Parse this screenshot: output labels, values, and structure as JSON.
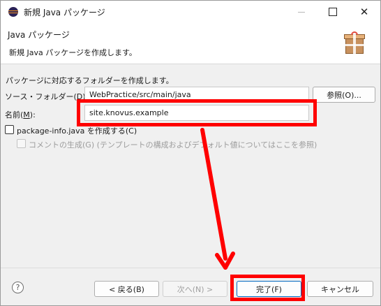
{
  "window": {
    "title": "新規 Java パッケージ"
  },
  "banner": {
    "title": "Java パッケージ",
    "description": "新規 Java パッケージを作成します。"
  },
  "form": {
    "instruction": "パッケージに対応するフォルダーを作成します。",
    "source_folder": {
      "label": "ソース・フォルダー(",
      "mnemonic": "D",
      "suffix": "):",
      "value": "WebPractice/src/main/java",
      "browse_button": "参照(O)..."
    },
    "name": {
      "label": "名前(",
      "mnemonic": "M",
      "suffix": "):",
      "value": "site.knovus.example"
    },
    "package_info": {
      "label": "package-info.java を作成する(C)",
      "checked": false
    },
    "comment": {
      "label": "コメントの生成(G) (テンプレートの構成およびデフォルト値についてはここを参照)",
      "checked": false,
      "disabled": true
    }
  },
  "footer": {
    "back_button": "< 戻る(B)",
    "next_button": "次へ(N) >",
    "finish_button": "完了(F)",
    "cancel_button": "キャンセル"
  },
  "colors": {
    "highlight": "#ff0000",
    "eclipse_icon": "#2c2255"
  },
  "icons": {
    "app": "eclipse-icon",
    "banner": "package-wizard-icon",
    "help": "help-icon"
  }
}
